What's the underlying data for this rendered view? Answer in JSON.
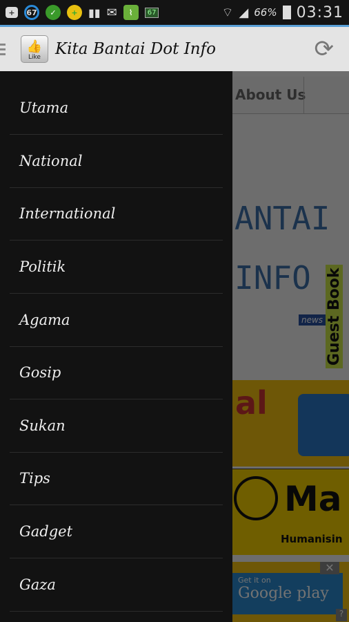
{
  "status_bar": {
    "notification_count": "67",
    "battery_percent": "66%",
    "time": "03:31",
    "battery_icon_level": "67"
  },
  "app_bar": {
    "title": "Kita Bantai Dot Info",
    "logo_label": "Like",
    "refresh_icon": "refresh-icon"
  },
  "background": {
    "tab": "About Us",
    "banner_lines": [
      "ANTAI",
      "INFO"
    ],
    "guest_book": "Guest Book",
    "news_badge": "news",
    "ad1_text": "al",
    "ad2_text": "Ma",
    "ad2_sub": "Humanisin",
    "ad3_small": "Get it on",
    "ad3_big": "Google play",
    "ad_close": "✕",
    "ad_help": "?"
  },
  "drawer": {
    "items": [
      {
        "label": "Utama"
      },
      {
        "label": "National"
      },
      {
        "label": "International"
      },
      {
        "label": "Politik"
      },
      {
        "label": "Agama"
      },
      {
        "label": "Gosip"
      },
      {
        "label": "Sukan"
      },
      {
        "label": "Tips"
      },
      {
        "label": "Gadget"
      },
      {
        "label": "Gaza"
      }
    ]
  }
}
